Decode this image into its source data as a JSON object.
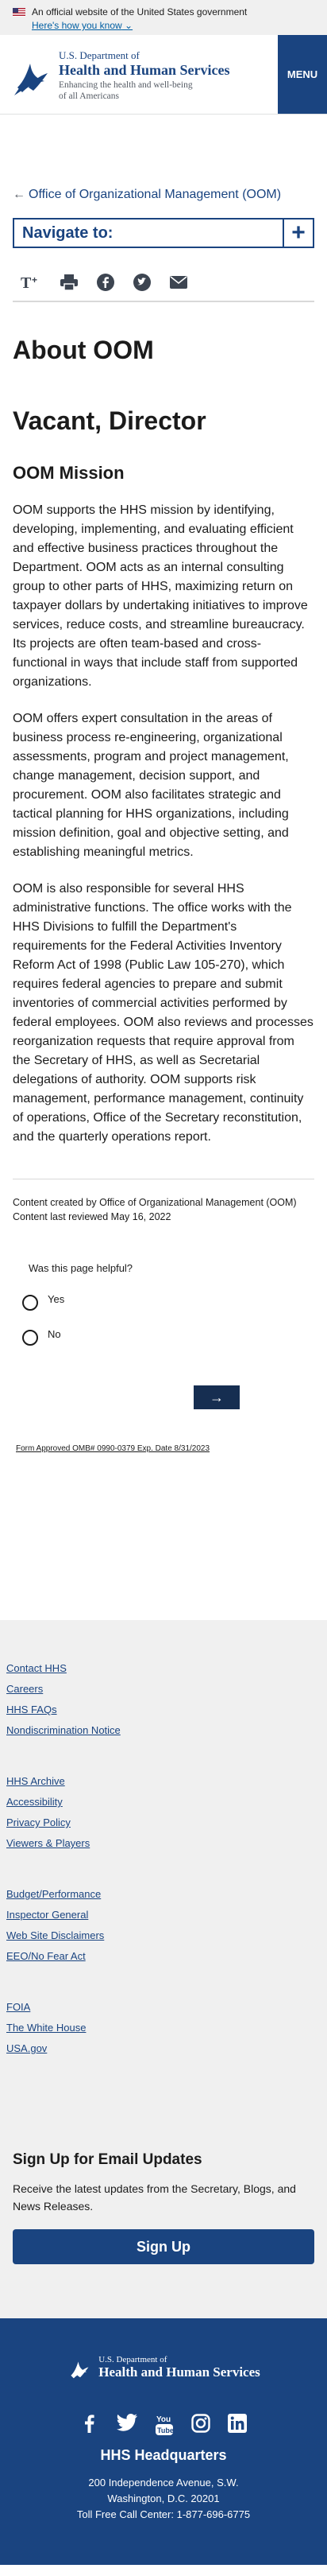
{
  "gov_banner": {
    "text": "An official website of the United States government",
    "link": "Here's how you know"
  },
  "header": {
    "dept_line": "U.S. Department of",
    "name": "Health and Human Services",
    "tagline_1": "Enhancing the health and well-being",
    "tagline_2": "of all Americans",
    "menu": "MENU"
  },
  "breadcrumb": {
    "back_label": "Office of Organizational Management (OOM)"
  },
  "nav_to": {
    "label": "Navigate to:"
  },
  "share_icons": [
    "text-size-icon",
    "print-icon",
    "facebook-icon",
    "twitter-icon",
    "email-icon"
  ],
  "content": {
    "title": "About OOM",
    "subtitle": "Vacant, Director",
    "section": "OOM Mission",
    "paragraphs": [
      "OOM supports the HHS mission by identifying, developing, implementing, and evaluating efficient and effective business practices throughout the Department. OOM acts as an internal consulting group to other parts of HHS, maximizing return on taxpayer dollars by undertaking initiatives to improve services, reduce costs, and streamline bureaucracy. Its projects are often team-based and cross-functional in ways that include staff from supported organizations.",
      "OOM offers expert consultation in the areas of business process re-engineering, organizational assessments, program and project management, change management, decision support, and procurement. OOM also facilitates strategic and tactical planning for HHS organizations, including mission definition, goal and objective setting, and establishing meaningful metrics.",
      "OOM is also responsible for several HHS administrative functions. The office works with the HHS Divisions to fulfill the Department's requirements for the Federal Activities Inventory Reform Act of 1998 (Public Law 105-270), which requires federal agencies to prepare and submit inventories of commercial activities performed by federal employees. OOM also reviews and processes reorganization requests that require approval from the Secretary of HHS, as well as Secretarial delegations of authority. OOM supports risk management, performance management, continuity of operations, Office of the Secretary reconstitution, and the quarterly operations report."
    ],
    "created_by": "Content created by Office of Organizational Management (OOM)",
    "last_reviewed": "Content last reviewed May 16, 2022"
  },
  "feedback": {
    "question": "Was this page helpful?",
    "yes": "Yes",
    "no": "No",
    "submit": "→",
    "omb": "Form Approved OMB# 0990-0379 Exp. Date 8/31/2023"
  },
  "footer": {
    "groups": [
      [
        "Contact HHS",
        "Careers",
        "HHS FAQs",
        "Nondiscrimination Notice"
      ],
      [
        "HHS Archive",
        "Accessibility",
        "Privacy Policy",
        "Viewers & Players"
      ],
      [
        "Budget/Performance",
        "Inspector General",
        "Web Site Disclaimers",
        "EEO/No Fear Act"
      ],
      [
        "FOIA",
        "The White House",
        "USA.gov"
      ]
    ],
    "signup_title": "Sign Up for Email Updates",
    "signup_text": "Receive the latest updates from the Secretary, Blogs, and News Releases.",
    "signup_button": "Sign Up",
    "dark_dept": "U.S. Department of",
    "dark_name": "Health and Human Services",
    "socials": [
      "facebook-icon",
      "twitter-icon",
      "youtube-icon",
      "instagram-icon",
      "linkedin-icon"
    ],
    "hq": "HHS Headquarters",
    "addr1": "200 Independence Avenue, S.W.",
    "addr2": "Washington, D.C. 20201",
    "phone": "Toll Free Call Center: 1-877-696-6775"
  },
  "colors": {
    "primary": "#1a4480",
    "dark": "#162e51",
    "link": "#005ea2",
    "banner_bg": "#f0f0f0"
  }
}
